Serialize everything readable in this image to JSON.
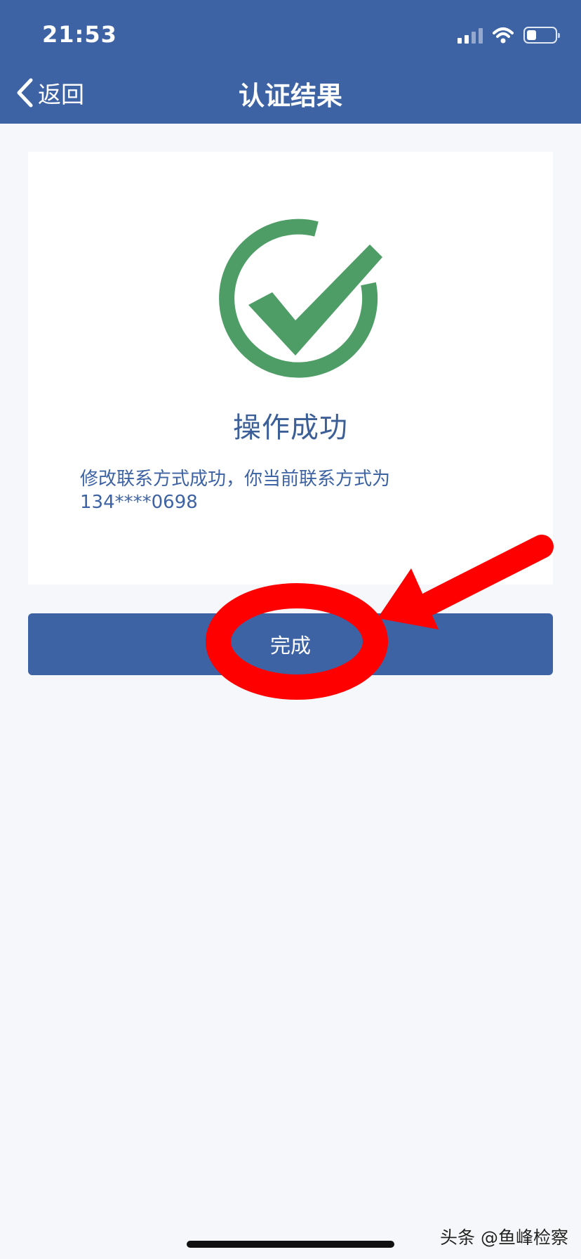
{
  "status_bar": {
    "time": "21:53",
    "signal_icon": "cellular-signal-icon",
    "wifi_icon": "wifi-icon",
    "battery_icon": "battery-icon",
    "battery_level": 0.35
  },
  "nav": {
    "back_icon": "chevron-left-icon",
    "back_label": "返回",
    "title": "认证结果"
  },
  "result": {
    "icon": "success-check-icon",
    "title": "操作成功",
    "description": "修改联系方式成功，你当前联系方式为134****0698"
  },
  "actions": {
    "done_label": "完成"
  },
  "annotation": {
    "arrow": "red-arrow-annotation",
    "circle": "red-circle-annotation"
  },
  "watermark": {
    "text": "头条 @鱼峰检察"
  },
  "colors": {
    "brand_blue": "#3d63a5",
    "success_green": "#4e9d66",
    "annotation_red": "#ff0000",
    "page_background": "#f5f7fa"
  }
}
